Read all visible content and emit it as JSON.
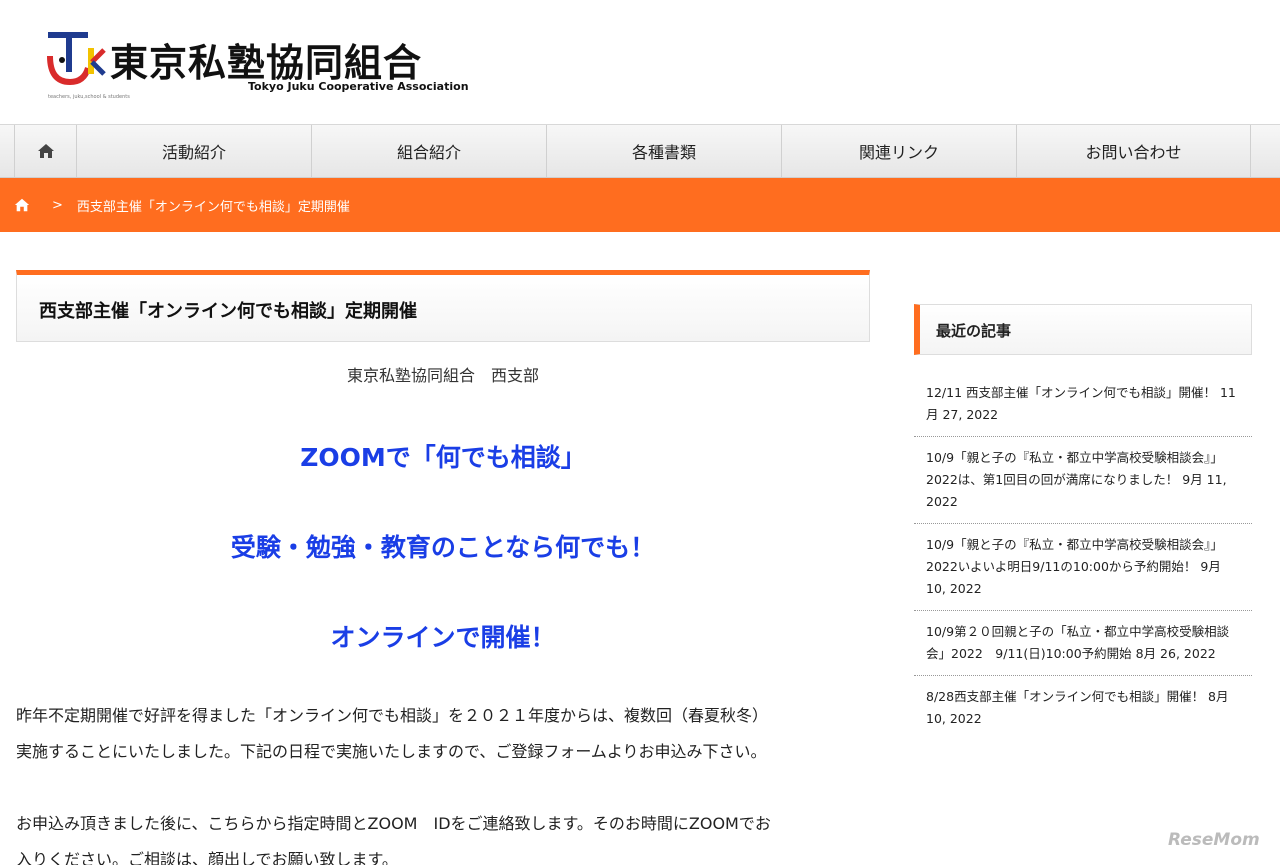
{
  "header": {
    "logo_text": "東京私塾協同組合",
    "logo_sub": "Tokyo Juku Cooperative Association",
    "logo_tiny": "teachers, juku,school & students"
  },
  "nav": {
    "items": [
      {
        "label": "活動紹介"
      },
      {
        "label": "組合紹介"
      },
      {
        "label": "各種書類"
      },
      {
        "label": "関連リンク"
      },
      {
        "label": "お問い合わせ"
      }
    ]
  },
  "breadcrumb": {
    "separator": ">",
    "current": "西支部主催「オンライン何でも相談」定期開催"
  },
  "article": {
    "title": "西支部主催「オンライン何でも相談」定期開催",
    "byline": "東京私塾協同組合　西支部",
    "headline1": "ZOOMで「何でも相談」",
    "headline2": "受験・勉強・教育のことなら何でも！",
    "headline3": "オンラインで開催！",
    "para1_line1": "昨年不定期開催で好評を得ました「オンライン何でも相談」を２０２１年度からは、複数回（春夏秋冬）",
    "para1_line2": "実施することにいたしました。下記の日程で実施いたしますので、ご登録フォームよりお申込み下さい。",
    "para2_line1": "お申込み頂きました後に、こちらから指定時間とZOOM　IDをご連絡致します。そのお時間にZOOMでお",
    "para2_line2": "入りください。ご相談は、顔出しでお願い致します。"
  },
  "sidebar": {
    "heading": "最近の記事",
    "posts": [
      {
        "text": "12/11 西支部主催「オンライン何でも相談」開催！ 11月 27, 2022"
      },
      {
        "text": "10/9「親と子の『私立・都立中学高校受験相談会』」2022は、第1回目の回が満席になりました！ 9月 11, 2022"
      },
      {
        "text": "10/9「親と子の『私立・都立中学高校受験相談会』」2022いよいよ明日9/11の10:00から予約開始！ 9月 10, 2022"
      },
      {
        "text": "10/9第２０回親と子の「私立・都立中学高校受験相談会」2022　9/11(日)10:00予約開始 8月 26, 2022"
      },
      {
        "text": "8/28西支部主催「オンライン何でも相談」開催！ 8月 10, 2022"
      }
    ]
  },
  "watermark": "ReseMom",
  "colors": {
    "accent": "#ff6d1f",
    "headline_blue": "#1a3ee6"
  }
}
